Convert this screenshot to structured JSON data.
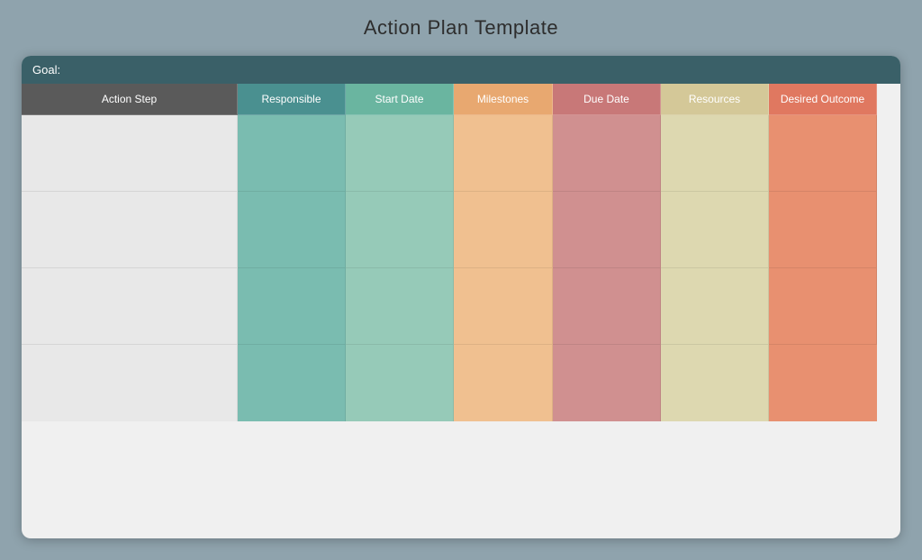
{
  "page": {
    "title": "Action Plan Template",
    "background_color": "#8fa3ad"
  },
  "goal_bar": {
    "label": "Goal:"
  },
  "columns": [
    {
      "id": "action-step",
      "label": "Action Step",
      "header_class": "hdr-action-step",
      "cell_class": "cell-action-step"
    },
    {
      "id": "responsible",
      "label": "Responsible",
      "header_class": "hdr-responsible",
      "cell_class": "cell-responsible"
    },
    {
      "id": "start-date",
      "label": "Start Date",
      "header_class": "hdr-start-date",
      "cell_class": "cell-start-date"
    },
    {
      "id": "milestones",
      "label": "Milestones",
      "header_class": "hdr-milestones",
      "cell_class": "cell-milestones"
    },
    {
      "id": "due-date",
      "label": "Due Date",
      "header_class": "hdr-due-date",
      "cell_class": "cell-due-date"
    },
    {
      "id": "resources",
      "label": "Resources",
      "header_class": "hdr-resources",
      "cell_class": "cell-resources"
    },
    {
      "id": "desired-outcome",
      "label": "Desired Outcome",
      "header_class": "hdr-desired-outcome",
      "cell_class": "cell-desired-outcome"
    }
  ],
  "rows": [
    {
      "id": "row1"
    },
    {
      "id": "row2"
    },
    {
      "id": "row3"
    },
    {
      "id": "row4"
    }
  ]
}
